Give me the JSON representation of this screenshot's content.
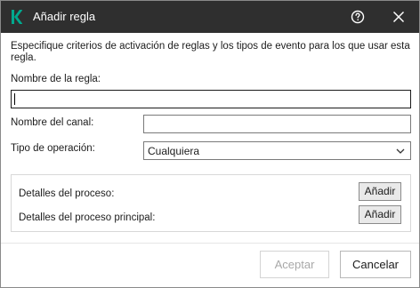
{
  "window": {
    "title": "Añadir regla",
    "icons": {
      "logo": "kaspersky-logo",
      "help": "help-icon",
      "close": "close-icon"
    },
    "colors": {
      "titlebar": "#2f2f2f",
      "logo_green": "#00a88e",
      "title_text": "#ffffff"
    }
  },
  "form": {
    "description": "Especifique criterios de activación de reglas y los tipos de evento para los que usar esta regla.",
    "rule_name": {
      "label": "Nombre de la regla:",
      "value": ""
    },
    "channel_name": {
      "label": "Nombre del canal:",
      "value": ""
    },
    "operation_type": {
      "label": "Tipo de operación:",
      "selected": "Cualquiera"
    }
  },
  "details": {
    "process": {
      "label": "Detalles del proceso:",
      "button": "Añadir"
    },
    "parent_process": {
      "label": "Detalles del proceso principal:",
      "button": "Añadir"
    }
  },
  "footer": {
    "accept_label": "Aceptar",
    "accept_enabled": false,
    "cancel_label": "Cancelar"
  }
}
